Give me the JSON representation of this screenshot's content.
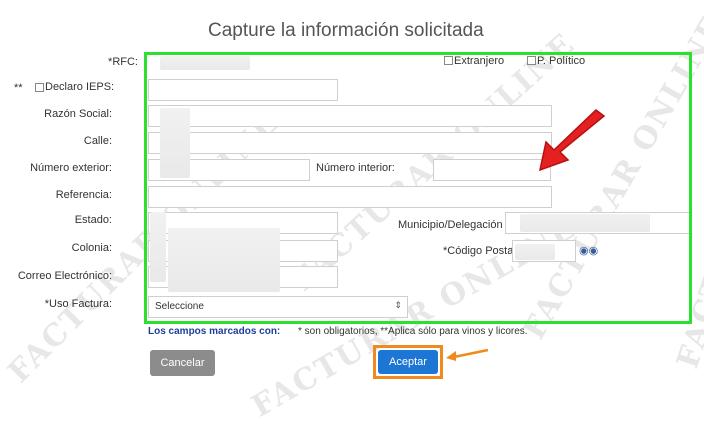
{
  "watermark": "FACTURAR ONLINE",
  "title": "Capture la información solicitada",
  "fields": {
    "rfc": "*RFC:",
    "ieps_prefix": "**",
    "ieps": "Declaro IEPS:",
    "razon_social": "Razón Social:",
    "calle": "Calle:",
    "numero_exterior": "Número exterior:",
    "numero_interior": "Número interior:",
    "referencia": "Referencia:",
    "estado": "Estado:",
    "municipio": "Municipio/Delegación",
    "colonia": "Colonia:",
    "codigo_postal": "*Código Posta",
    "correo": "Correo Electrónico:",
    "uso_factura": "*Uso Factura:"
  },
  "checkboxes": {
    "extranjero": "Extranjero",
    "p_politico": "P. Político"
  },
  "select": {
    "uso_factura_value": "Seleccione"
  },
  "note": {
    "link": "Los campos marcados con:",
    "text": "* son obligatorios, **Aplica sólo para vinos y licores."
  },
  "buttons": {
    "cancel": "Cancelar",
    "accept": "Aceptar"
  },
  "colors": {
    "highlight_box": "#2ee02e",
    "arrow_red": "#e52020",
    "accept_orange": "#f08a1c",
    "accept_blue": "#1e76d4"
  }
}
